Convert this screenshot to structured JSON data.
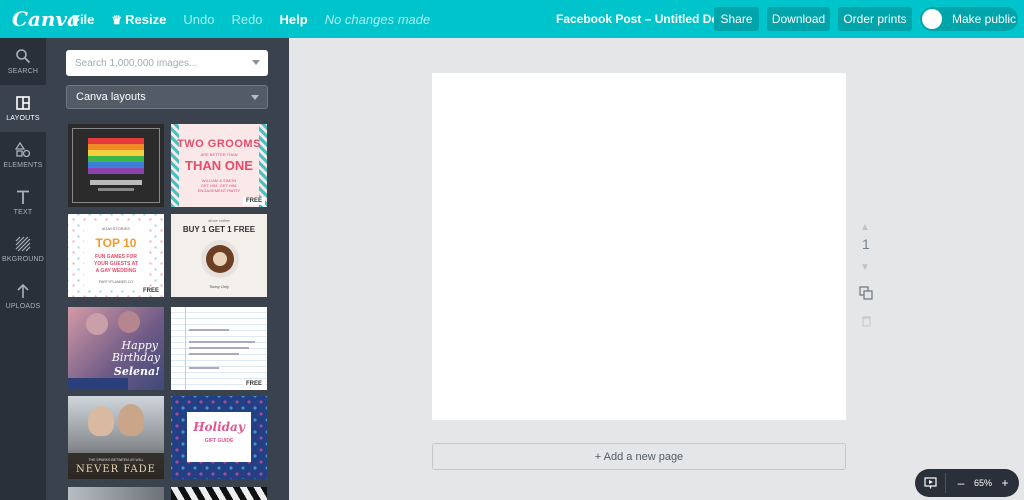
{
  "topbar": {
    "logo": "Canva",
    "menu": [
      "File",
      "Resize",
      "Undo",
      "Redo",
      "Help"
    ],
    "status": "No changes made",
    "title": "Facebook Post – Untitled Design",
    "share": "Share",
    "download": "Download",
    "order": "Order prints",
    "make_public": "Make public"
  },
  "rail": [
    {
      "label": "SEARCH",
      "icon": "search-icon"
    },
    {
      "label": "LAYOUTS",
      "icon": "layouts-icon"
    },
    {
      "label": "ELEMENTS",
      "icon": "shapes-icon"
    },
    {
      "label": "TEXT",
      "icon": "text-icon"
    },
    {
      "label": "BKGROUND",
      "icon": "background-icon"
    },
    {
      "label": "UPLOADS",
      "icon": "upload-arrow-icon"
    }
  ],
  "panel": {
    "search_placeholder": "Search 1,000,000 images...",
    "select_value": "Canva layouts",
    "free_badge": "FREE",
    "t2": {
      "line1": "TWO GROOMS",
      "line2": "ARE BETTER THAN",
      "line3": "THAN ONE",
      "line4": "WILLIAM & SIMON",
      "line5": "GET HIM. GET HIM.",
      "line6": "ENGAGEMENT PARTY"
    },
    "t3": {
      "top": "#GAYSTORIES",
      "line1": "TOP 10",
      "line2": "FUN GAMES FOR",
      "line3": "YOUR GUESTS AT",
      "line4": "A GAY WEDDING",
      "foot": "PARTYPLANNER.CO"
    },
    "t4": {
      "top": "#love coffee",
      "line1": "BUY 1 GET 1 FREE",
      "foot": "Today Only"
    },
    "t5": {
      "line1": "Happy",
      "line2": "Birthday",
      "line3": "Selena!"
    },
    "t7": {
      "line1": "NEVER FADE",
      "top": "THE SPARKS BETWEEN US WILL"
    },
    "t8": {
      "line1": "Holiday",
      "line2": "GIFT GUIDE"
    }
  },
  "canvas": {
    "page_number": "1",
    "add_page": "+ Add a new page"
  },
  "zoom": {
    "minus": "–",
    "value": "65%",
    "plus": "+"
  },
  "colors": {
    "brand": "#00c4cc",
    "button": "#00a4ab",
    "rail": "#293039",
    "panel": "#3a424d"
  }
}
